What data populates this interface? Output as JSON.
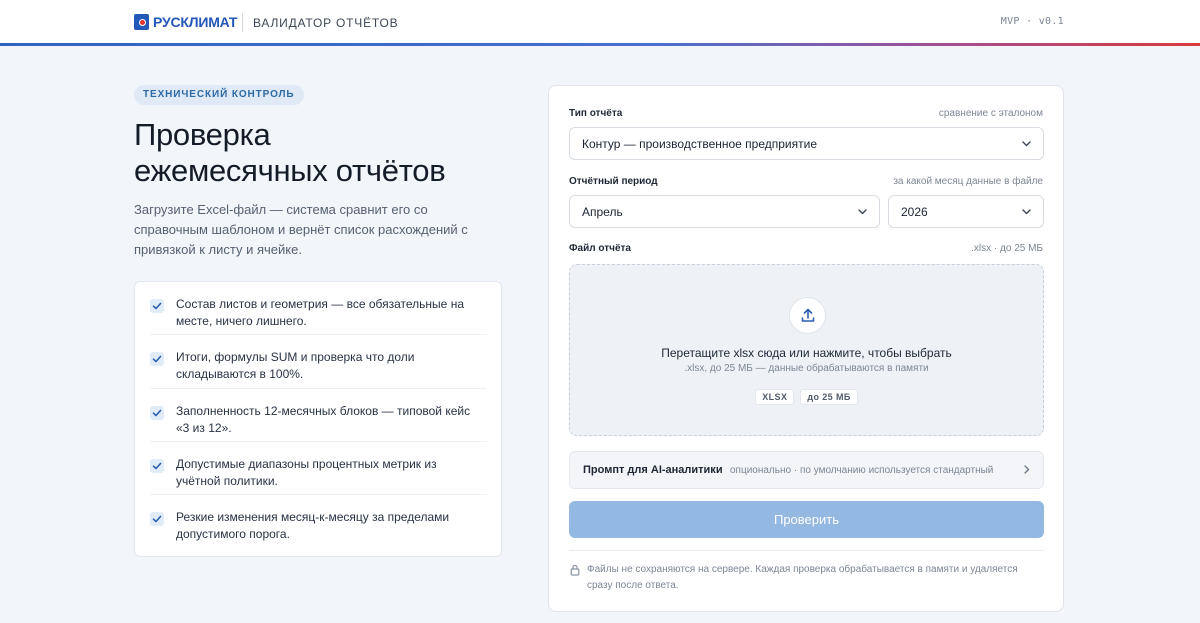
{
  "header": {
    "brand": "РУСКЛИМАТ",
    "app_title": "ВАЛИДАТОР ОТЧЁТОВ",
    "version": "MVP · v0.1",
    "brand_colors": {
      "blue": "#2458b8",
      "red": "#e03131"
    }
  },
  "intro": {
    "badge": "ТЕХНИЧЕСКИЙ КОНТРОЛЬ",
    "title_line1": "Проверка",
    "title_line2": "ежемесячных отчётов",
    "description": "Загрузите Excel-файл — система сравнит его со справочным шаблоном и вернёт список расхождений с привязкой к листу и ячейке."
  },
  "checks": [
    {
      "text": "Состав листов и геометрия — все обязательные на месте, ничего лишнего."
    },
    {
      "text": "Итоги, формулы SUM и проверка что доли складываются в 100%."
    },
    {
      "text": "Заполненность 12-месячных блоков — типовой кейс «3 из 12»."
    },
    {
      "text": "Допустимые диапазоны процентных метрик из учётной политики."
    },
    {
      "text": "Резкие изменения месяц-к-месяцу за пределами допустимого порога."
    }
  ],
  "form": {
    "report_type": {
      "label": "Тип отчёта",
      "hint": "сравнение с эталоном",
      "value": "Контур — производственное предприятие"
    },
    "period": {
      "label": "Отчётный период",
      "hint": "за какой месяц данные в файле",
      "month": "Апрель",
      "year": "2026"
    },
    "file": {
      "label": "Файл отчёта",
      "hint": ".xlsx · до 25 МБ",
      "drop_title": "Перетащите xlsx сюда или нажмите, чтобы выбрать",
      "drop_subtitle": ".xlsx, до 25 МБ — данные обрабатываются в памяти",
      "chips": [
        "XLSX",
        "до 25 МБ"
      ]
    },
    "prompt": {
      "label": "Промпт для AI-аналитики",
      "hint": "опционально · по умолчанию используется стандартный"
    },
    "submit_label": "Проверить",
    "footnote": "Файлы не сохраняются на сервере. Каждая проверка обрабатывается в памяти и удаляется сразу после ответа."
  },
  "colors": {
    "accent": "#2458b8",
    "submit_disabled": "#93b8e2",
    "badge_bg": "#dfeaf6",
    "badge_text": "#2e6aa5"
  },
  "icons": {
    "logo": "rusklimat-logo-icon",
    "check": "checkmark-icon",
    "select_chevron": "chevron-down-icon",
    "upload": "upload-icon",
    "prompt_chevron": "chevron-right-icon",
    "lock": "lock-icon"
  }
}
